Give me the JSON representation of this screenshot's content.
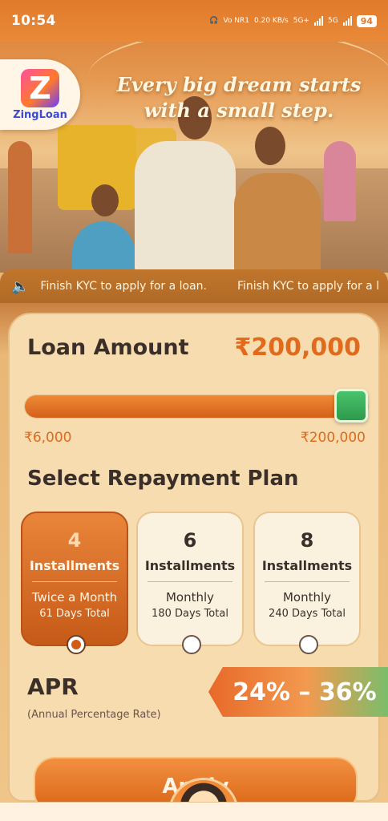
{
  "status_bar": {
    "time": "10:54",
    "network": "Vo NR1",
    "speed": "0.20 KB/s",
    "sig1": "5G+",
    "sig2": "5G",
    "battery": "94"
  },
  "hero": {
    "headline_line1": "Every big dream starts",
    "headline_line2": "with a small step.",
    "logo_letter": "Z",
    "logo_text": "ZingLoan"
  },
  "marquee": {
    "icon": "speaker-icon",
    "message": "Finish KYC to apply for a loan.",
    "message_partial": "Finish KYC to apply for a l"
  },
  "loan": {
    "title": "Loan Amount",
    "amount": "₹200,000",
    "min": "₹6,000",
    "max": "₹200,000",
    "slider_fraction": 1.0
  },
  "plans": {
    "title": "Select Repayment Plan",
    "items": [
      {
        "number": "4",
        "label": "Installments",
        "frequency": "Twice a Month",
        "days": "61 Days Total",
        "selected": true
      },
      {
        "number": "6",
        "label": "Installments",
        "frequency": "Monthly",
        "days": "180 Days Total",
        "selected": false
      },
      {
        "number": "8",
        "label": "Installments",
        "frequency": "Monthly",
        "days": "240 Days Total",
        "selected": false
      }
    ]
  },
  "apr": {
    "title": "APR",
    "subtitle": "(Annual Percentage Rate)",
    "value": "24% – 36%"
  },
  "apply": {
    "label": "Apply"
  },
  "colors": {
    "accent": "#e06b1d",
    "thumb": "#2e9a4c"
  }
}
